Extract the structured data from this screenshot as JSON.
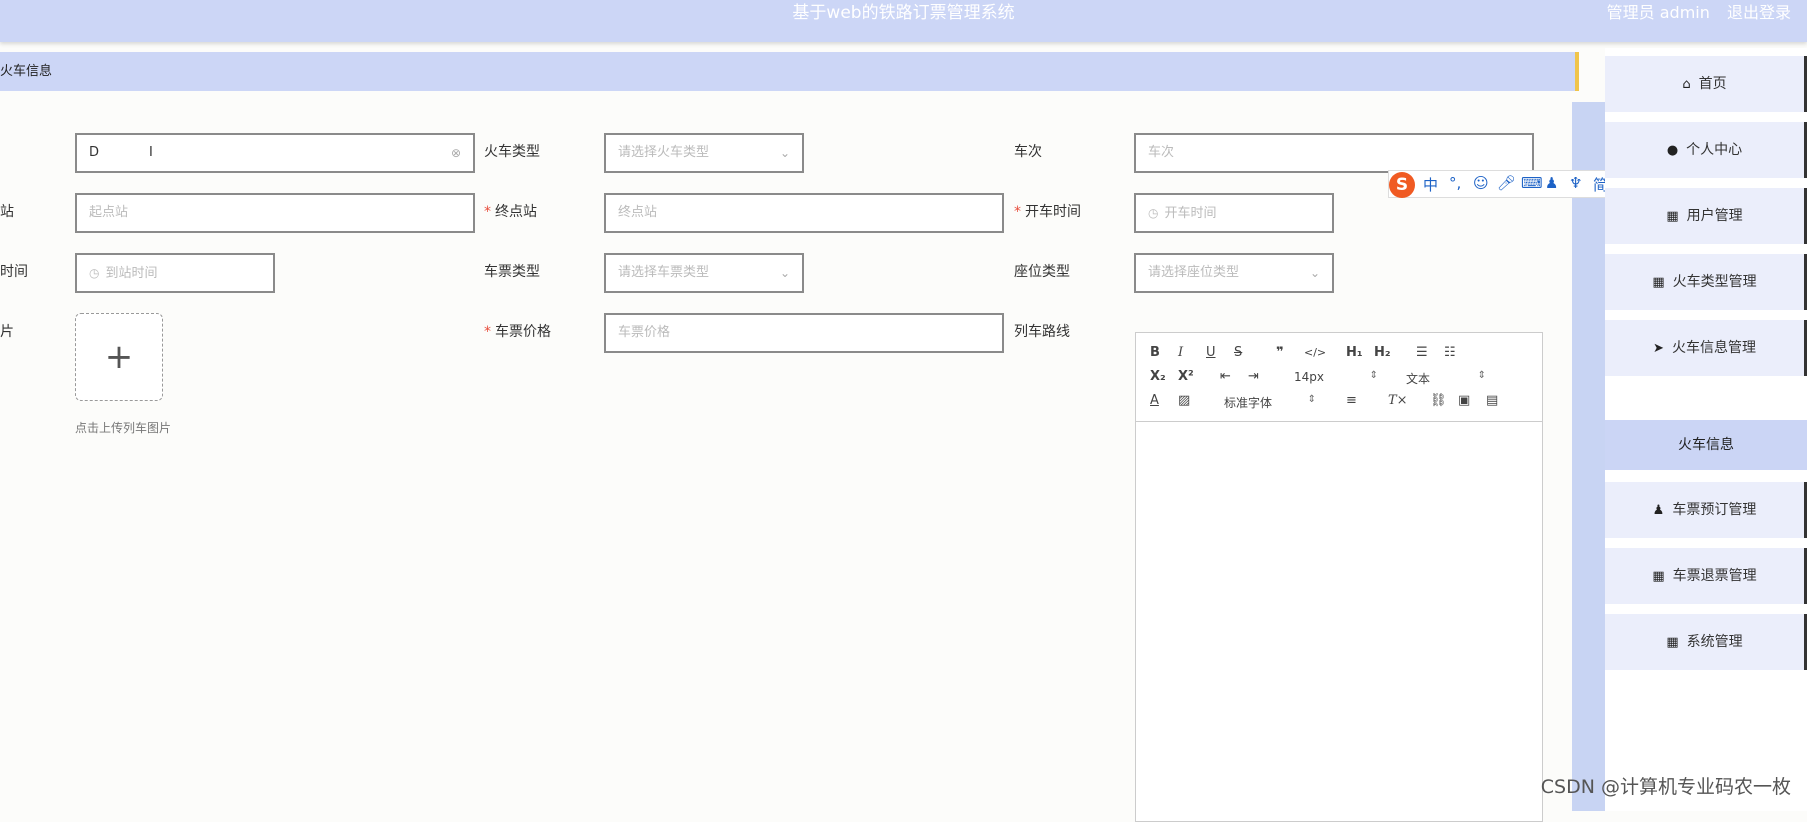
{
  "header": {
    "title": "基于web的铁路订票管理系统",
    "user_label": "管理员 admin",
    "logout_label": "退出登录"
  },
  "breadcrumb": {
    "current": "火车信息"
  },
  "form": {
    "train_number_value": "D",
    "train_type_label": "火车类型",
    "train_type_placeholder": "请选择火车类型",
    "train_no_label": "车次",
    "train_no_placeholder": "车次",
    "start_station_label_fragment": "站",
    "start_station_placeholder": "起点站",
    "end_station_label": "终点站",
    "end_station_placeholder": "终点站",
    "depart_time_label": "开车时间",
    "depart_time_placeholder": "开车时间",
    "arrive_time_label_fragment": "时间",
    "arrive_time_placeholder": "到站时间",
    "ticket_type_label": "车票类型",
    "ticket_type_placeholder": "请选择车票类型",
    "seat_type_label": "座位类型",
    "seat_type_placeholder": "请选择座位类型",
    "image_label_fragment": "片",
    "upload_hint": "点击上传列车图片",
    "price_label": "车票价格",
    "price_placeholder": "车票价格",
    "route_label": "列车路线",
    "required_mark": "*"
  },
  "editor": {
    "font_size": "14px",
    "block_type": "文本",
    "font_family": "标准字体"
  },
  "ime": {
    "mode": "中"
  },
  "sidebar": {
    "items": [
      {
        "label": "首页",
        "icon": "home-icon"
      },
      {
        "label": "个人中心",
        "icon": "user-icon"
      },
      {
        "label": "用户管理",
        "icon": "grid-icon"
      },
      {
        "label": "火车类型管理",
        "icon": "grid-icon"
      },
      {
        "label": "火车信息管理",
        "icon": "send-icon"
      },
      {
        "label": "车票预订管理",
        "icon": "stamp-icon"
      },
      {
        "label": "车票退票管理",
        "icon": "grid-icon"
      },
      {
        "label": "系统管理",
        "icon": "grid-icon"
      }
    ],
    "active_sub": "火车信息"
  },
  "watermark": "CSDN @计算机专业码农一枚"
}
